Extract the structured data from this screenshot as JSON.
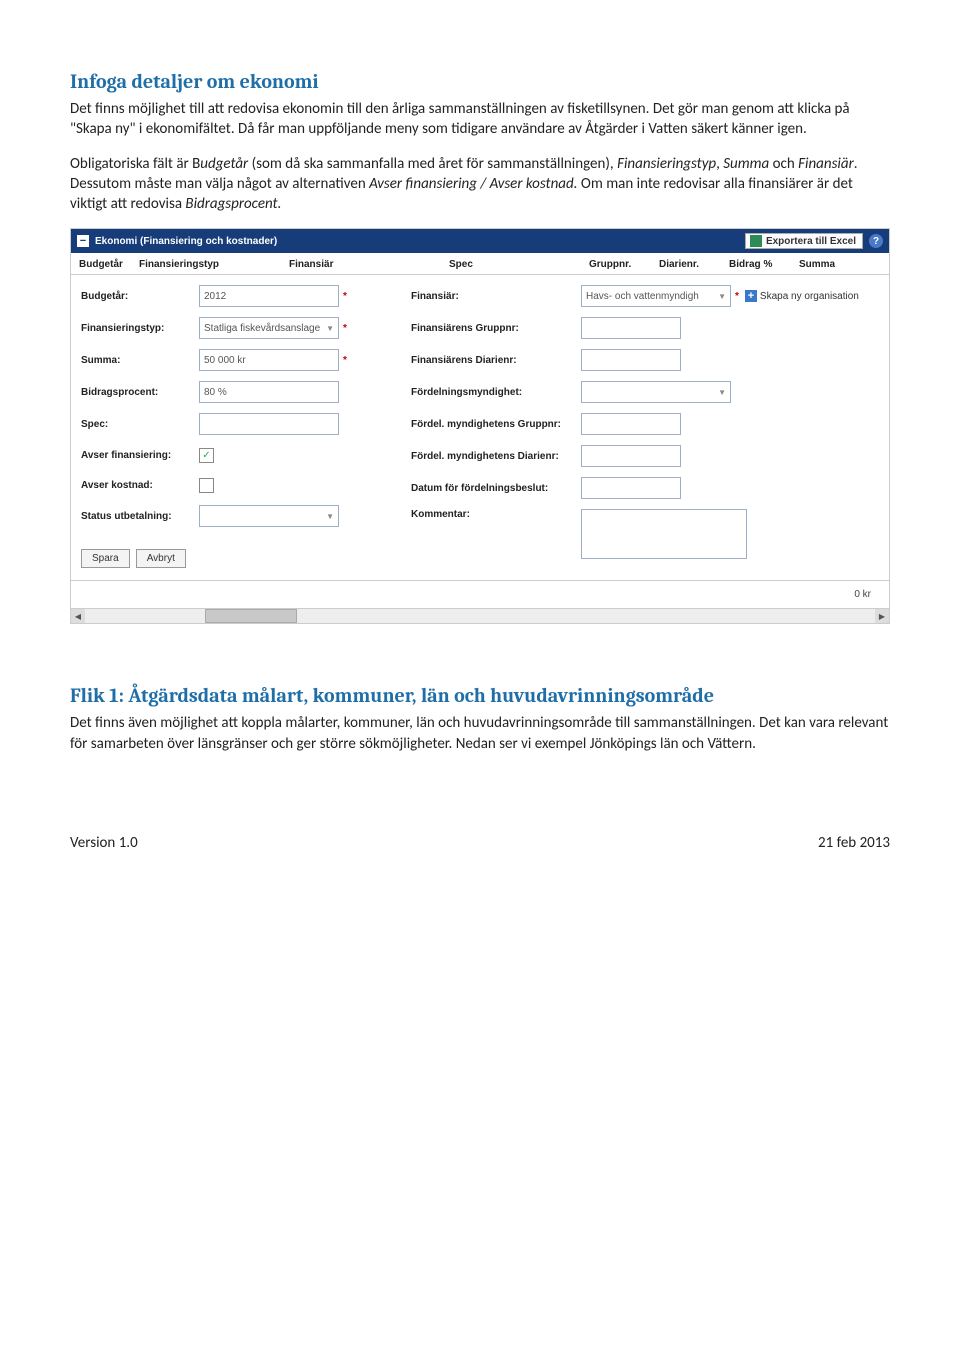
{
  "heading1": "Infoga detaljer om ekonomi",
  "para1": "Det finns möjlighet till att redovisa ekonomin till den årliga sammanställningen av fisketillsynen. Det gör man genom att klicka på \"Skapa ny\" i ekonomifältet. Då får man uppföljande meny som tidigare användare av Åtgärder i Vatten säkert känner igen.",
  "para2_a": "Obligatoriska fält är B",
  "para2_i1": "udgetår",
  "para2_b": " (som då ska sammanfalla med året för sammanställningen), ",
  "para2_i2": "Finansieringstyp",
  "para2_c": ", ",
  "para2_i3": "Summa",
  "para2_d": " och ",
  "para2_i4": "Finansiär",
  "para2_e": ". Dessutom måste man välja något av alternativen ",
  "para2_i5": "Avser finansiering / Avser kostnad.",
  "para2_f": " Om man inte redovisar alla finansiärer är det viktigt att redovisa ",
  "para2_i6": "Bidragsprocent.",
  "panel_title": "Ekonomi (Finansiering och kostnader)",
  "export_label": "Exportera till Excel",
  "grid_headers": {
    "c1": "Budgetår",
    "c2": "Finansieringstyp",
    "c3": "Finansiär",
    "c4": "Spec",
    "c5": "Gruppnr.",
    "c6": "Diarienr.",
    "c7": "Bidrag %",
    "c8": "Summa"
  },
  "left_labels": {
    "budgetar": "Budgetår:",
    "fin_typ": "Finansieringstyp:",
    "summa": "Summa:",
    "bidrag": "Bidragsprocent:",
    "spec": "Spec:",
    "avs_fin": "Avser finansiering:",
    "avs_kost": "Avser kostnad:",
    "status": "Status utbetalning:"
  },
  "left_values": {
    "budgetar": "2012",
    "fin_typ": "Statliga fiskevårdsanslage",
    "summa": "50 000 kr",
    "bidrag": "80 %",
    "spec": "",
    "avs_fin_checked": "✓",
    "status": ""
  },
  "right_labels": {
    "finansiar": "Finansiär:",
    "fin_grupp": "Finansiärens Gruppnr:",
    "fin_diarie": "Finansiärens Diarienr:",
    "fordeln": "Fördelningsmyndighet:",
    "ford_grupp": "Fördel. myndighetens Gruppnr:",
    "ford_diarie": "Fördel. myndighetens Diarienr:",
    "datum": "Datum för fördelningsbeslut:",
    "kommentar": "Kommentar:"
  },
  "right_values": {
    "finansiar": "Havs- och vattenmyndigh"
  },
  "skapa_org": "Skapa ny organisation",
  "spara": "Spara",
  "avbryt": "Avbryt",
  "sum_value": "0 kr",
  "heading2": "Flik 1: Åtgärdsdata målart, kommuner, län och huvudavrinningsområde",
  "para3": "Det finns även möjlighet att koppla målarter, kommuner, län och huvudavrinningsområde till sammanställningen. Det kan vara relevant för samarbeten över länsgränser och ger större sökmöjligheter. Nedan ser vi exempel Jönköpings län och Vättern.",
  "footer_left": "Version 1.0",
  "footer_right": "21 feb 2013"
}
